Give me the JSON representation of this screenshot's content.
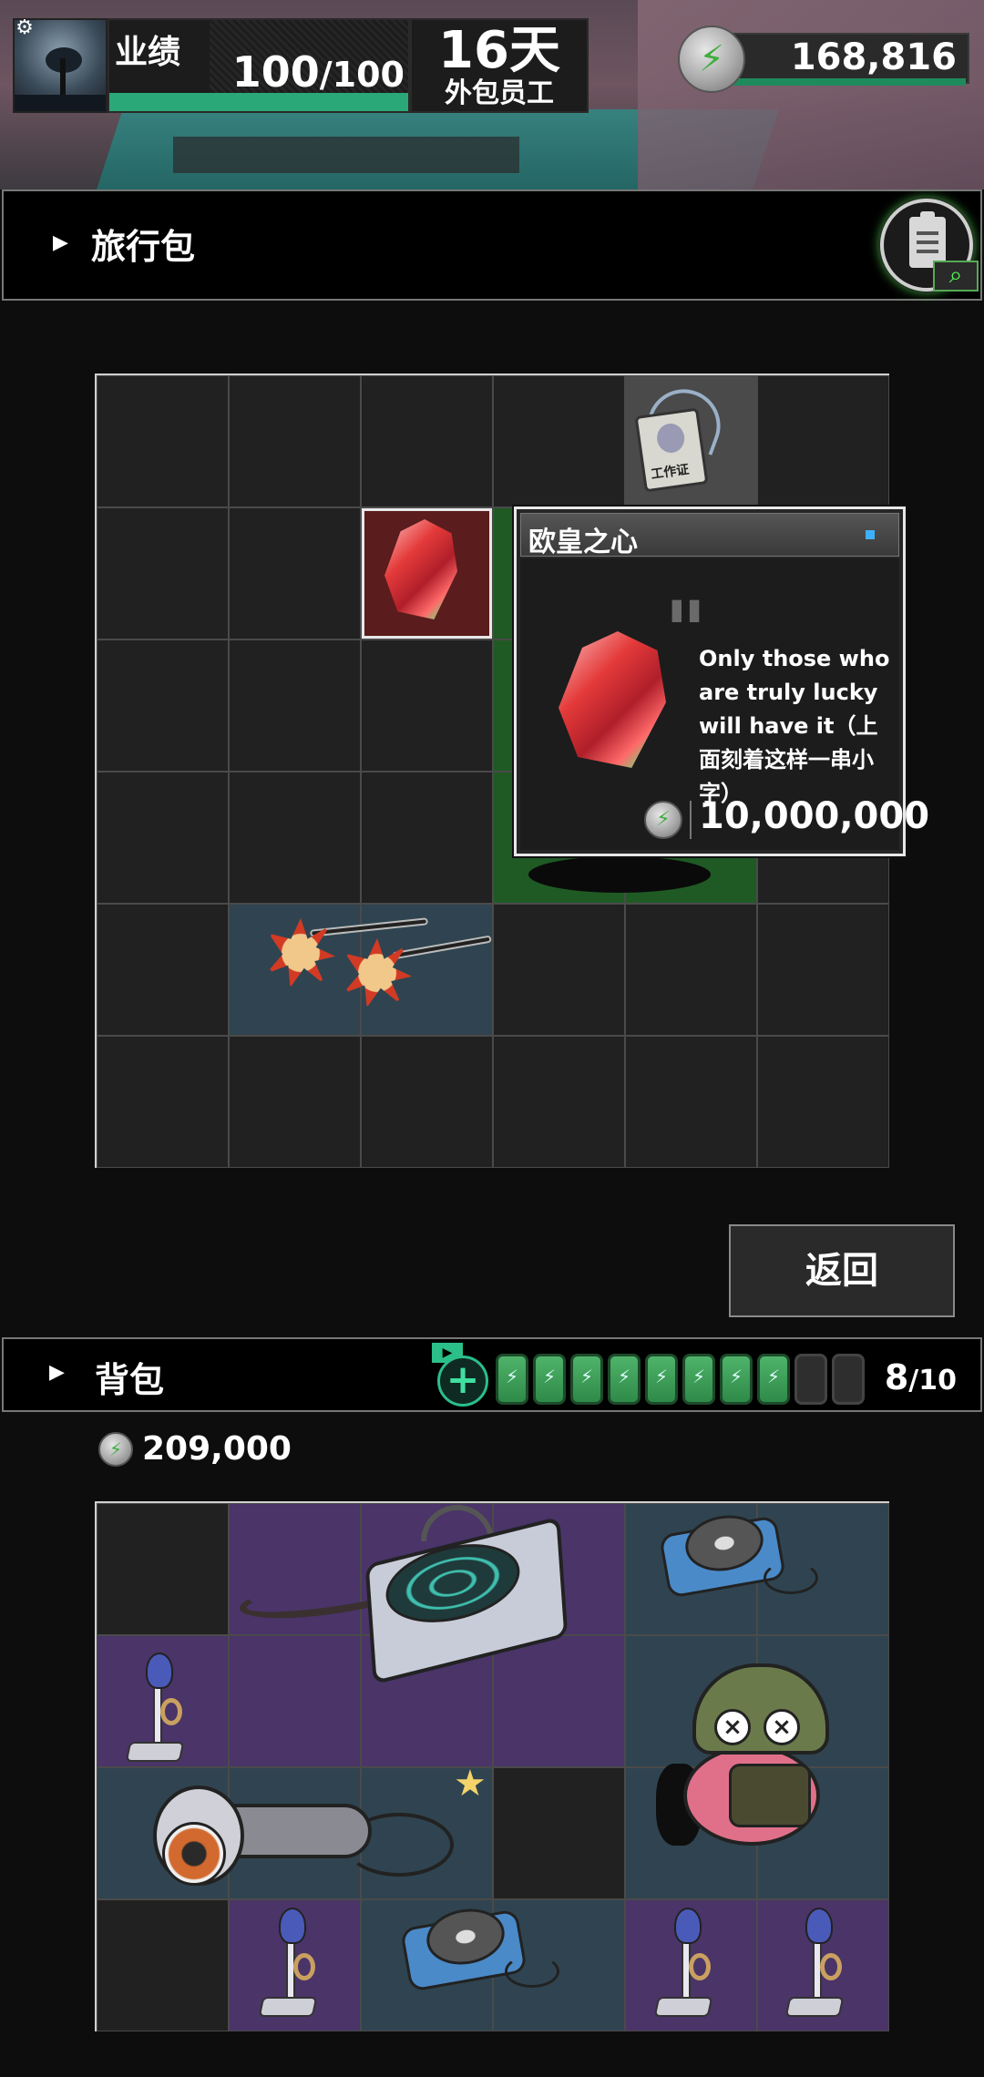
{
  "hud": {
    "performance_label": "业绩",
    "performance_current": "100",
    "performance_max": "/100",
    "performance_fraction": 1.0,
    "day_count": "16天",
    "role": "外包员工",
    "coin_total": "168,816",
    "icons": [
      "gear-icon",
      "coin-icon"
    ]
  },
  "travel_bag": {
    "title": "旅行包",
    "manifest_icons": [
      "clipboard-icon",
      "search-icon"
    ],
    "items": [
      "work-id-badge",
      "lucky-heart-gem",
      "dark-creature",
      "sun-sunglasses"
    ]
  },
  "tooltip": {
    "title": "欧皇之心",
    "description": "Only those who are truly lucky will have it（上面刻着这样一串小字）",
    "price": "10,000,000"
  },
  "back_button": {
    "label": "返回"
  },
  "backpack": {
    "title": "背包",
    "battery_count": "8",
    "battery_max": "/10",
    "battery_filled": 8,
    "battery_capacity": 10,
    "money": "209,000",
    "items": [
      "radar-device",
      "cd-player",
      "trophy",
      "frog-soldier",
      "hair-dryer",
      "star"
    ]
  },
  "colors": {
    "accent_green": "#2bbf8a",
    "cell_gray": "#212121",
    "cell_purple": "#4a3468",
    "cell_teal": "#2f4450",
    "cell_maroon": "#5a1c1c",
    "cell_green": "#1f5a24"
  }
}
